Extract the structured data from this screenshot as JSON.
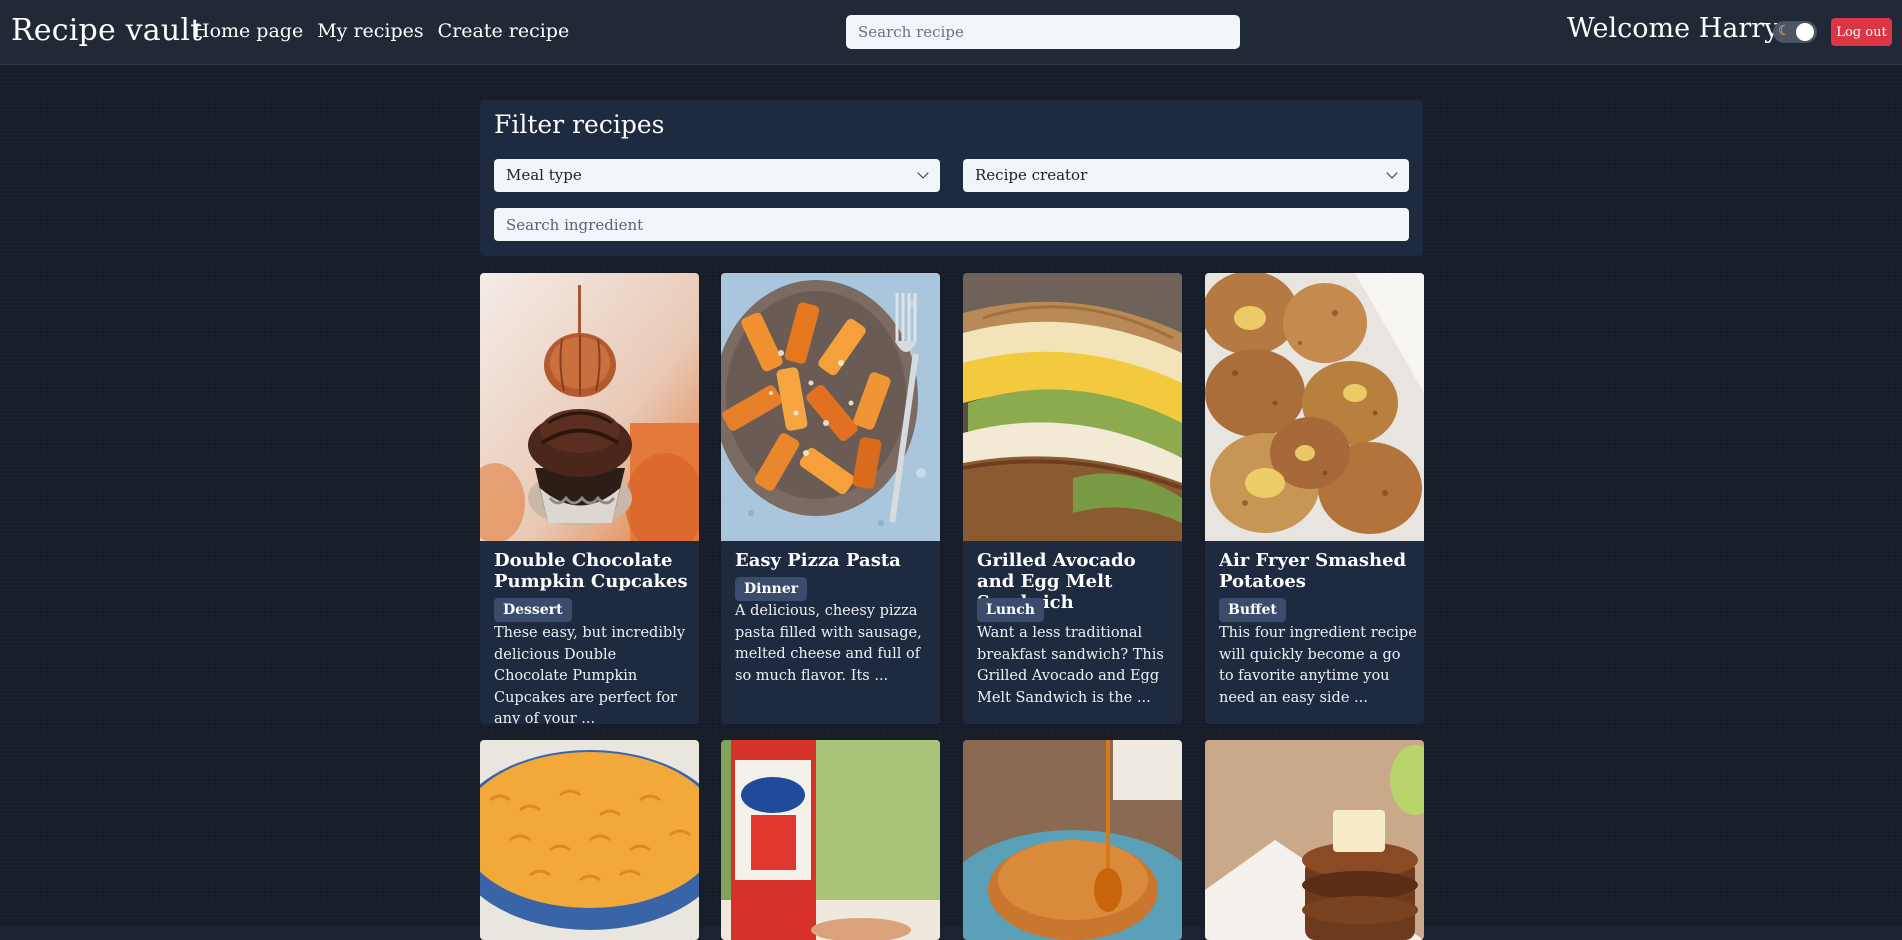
{
  "app": {
    "brand": "Recipe vault",
    "nav": [
      "Home page",
      "My recipes",
      "Create recipe"
    ],
    "search_placeholder": "Search recipe",
    "welcome": "Welcome Harry",
    "logout_label": "Log out",
    "theme_toggle_icon": "moon-icon"
  },
  "filter": {
    "title": "Filter recipes",
    "meal_type_label": "Meal type",
    "creator_label": "Recipe creator",
    "ingredient_placeholder": "Search ingredient"
  },
  "recipes": [
    {
      "title": "Double Chocolate Pumpkin Cupcakes",
      "tag": "Dessert",
      "description": "These easy, but incredibly delicious Double Chocolate Pumpkin Cupcakes are perfect for any of your ...",
      "image": "cupcake-photo"
    },
    {
      "title": "Easy Pizza Pasta",
      "tag": "Dinner",
      "description": "A delicious, cheesy pizza pasta filled with sausage, melted cheese and full of so much flavor. Its ...",
      "image": "pasta-photo"
    },
    {
      "title": "Grilled Avocado and Egg Melt Sandwich",
      "tag": "Lunch",
      "description": "Want a less traditional breakfast sandwich? This Grilled Avocado and Egg Melt Sandwich is the ...",
      "image": "sandwich-photo"
    },
    {
      "title": "Air Fryer Smashed Potatoes",
      "tag": "Buffet",
      "description": "This four ingredient recipe will quickly become a go to favorite anytime you need an easy side ...",
      "image": "potatoes-photo"
    }
  ],
  "recipes_row2": [
    {
      "image": "mac-and-cheese-photo"
    },
    {
      "image": "wing-sauce-photo"
    },
    {
      "image": "syrup-pancake-photo"
    },
    {
      "image": "pancake-stack-photo"
    }
  ]
}
